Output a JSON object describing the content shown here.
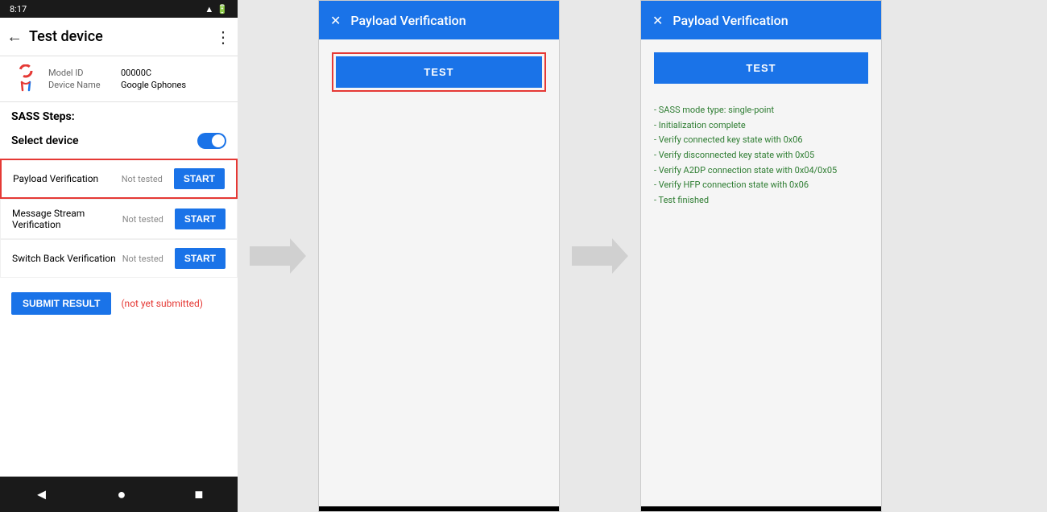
{
  "statusBar": {
    "time": "8:17",
    "icons": [
      "notification",
      "sync",
      "settings",
      "wifi",
      "signal"
    ]
  },
  "topBar": {
    "title": "Test device",
    "backLabel": "←",
    "menuLabel": "⋮"
  },
  "device": {
    "modelIdLabel": "Model ID",
    "modelIdValue": "00000C",
    "deviceNameLabel": "Device Name",
    "deviceNameValue": "Google Gphones"
  },
  "sass": {
    "title": "SASS Steps:",
    "selectDeviceLabel": "Select device"
  },
  "steps": [
    {
      "name": "Payload Verification",
      "status": "Not tested",
      "btnLabel": "START",
      "highlighted": true
    },
    {
      "name": "Message Stream Verification",
      "status": "Not tested",
      "btnLabel": "START",
      "highlighted": false
    },
    {
      "name": "Switch Back Verification",
      "status": "Not tested",
      "btnLabel": "START",
      "highlighted": false
    }
  ],
  "submit": {
    "btnLabel": "SUBMIT RESULT",
    "statusText": "(not yet submitted)"
  },
  "navBar": {
    "back": "◄",
    "home": "●",
    "recent": "■"
  },
  "dialog1": {
    "title": "Payload Verification",
    "closeLabel": "✕",
    "testBtnLabel": "TEST"
  },
  "dialog2": {
    "title": "Payload Verification",
    "closeLabel": "✕",
    "testBtnLabel": "TEST",
    "results": [
      "- SASS mode type: single-point",
      "- Initialization complete",
      "- Verify connected key state with 0x06",
      "- Verify disconnected key state with 0x05",
      "- Verify A2DP connection state with 0x04/0x05",
      "- Verify HFP connection state with 0x06",
      "- Test finished"
    ]
  }
}
